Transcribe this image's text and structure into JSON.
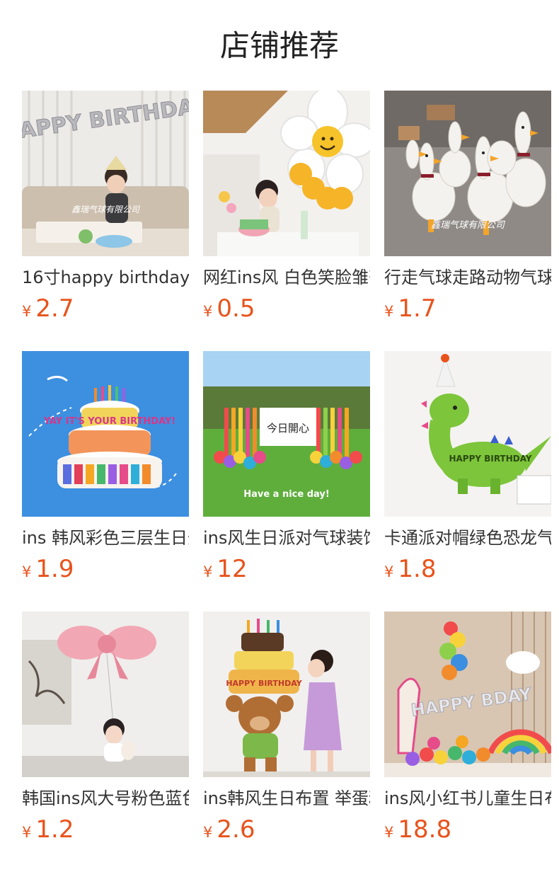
{
  "page_title": "店铺推荐",
  "accent_color": "#e8531c",
  "products": [
    {
      "name": "16寸happy birthday",
      "currency": "¥",
      "price": "2.7",
      "watermark": "鑫瑞气球有限公司",
      "image_text": "HAPPY BIRTHDAY",
      "image_icon": "happy-birthday-letter-balloons-child-image"
    },
    {
      "name": "网红ins风 白色笑脸雏菊",
      "currency": "¥",
      "price": "0.5",
      "image_icon": "daisy-smiley-balloon-child-image"
    },
    {
      "name": "行走气球走路动物气球",
      "currency": "¥",
      "price": "1.7",
      "watermark": "鑫瑞气球有限公司",
      "image_icon": "walking-goose-balloons-image"
    },
    {
      "name": "ins 韩风彩色三层生日蛋糕",
      "currency": "¥",
      "price": "1.9",
      "image_text": "YAY IT'S YOUR BIRTHDAY!",
      "image_icon": "birthday-cake-balloon-image"
    },
    {
      "name": "ins风生日派对气球装饰",
      "currency": "¥",
      "price": "12",
      "image_text": "今日開心",
      "image_caption": "Have a nice day!",
      "image_icon": "outdoor-party-balloon-decoration-image"
    },
    {
      "name": "卡通派对帽绿色恐龙气球",
      "currency": "¥",
      "price": "1.8",
      "image_text": "HAPPY BIRTHDAY",
      "image_icon": "green-dinosaur-balloon-image"
    },
    {
      "name": "韩国ins风大号粉色蓝色蝴蝶结",
      "currency": "¥",
      "price": "1.2",
      "image_icon": "pink-bow-balloon-child-image"
    },
    {
      "name": "ins韩风生日布置 举蛋糕小熊",
      "currency": "¥",
      "price": "2.6",
      "image_text": "HAPPY BIRTHDAY",
      "image_icon": "bear-holding-cake-balloon-image"
    },
    {
      "name": "ins风小红书儿童生日布置",
      "currency": "¥",
      "price": "18.8",
      "image_text": "HAPPY BDAY",
      "image_icon": "rainbow-number-balloon-arrangement-image"
    }
  ]
}
